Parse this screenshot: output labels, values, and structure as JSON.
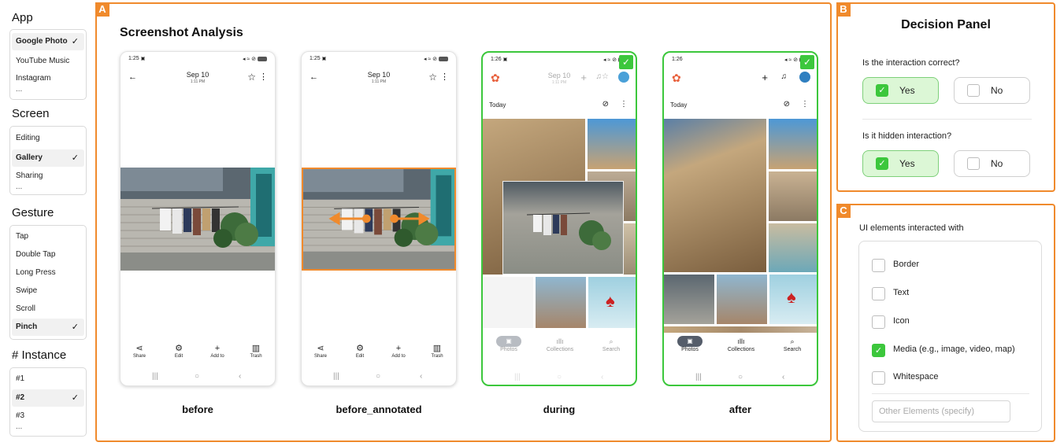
{
  "sidebar": {
    "app": {
      "title": "App",
      "options": [
        "Google Photo",
        "YouTube Music",
        "Instagram"
      ],
      "selected_index": 0
    },
    "screen": {
      "title": "Screen",
      "options": [
        "Editing",
        "Gallery",
        "Sharing"
      ],
      "selected_index": 1
    },
    "gesture": {
      "title": "Gesture",
      "options": [
        "Tap",
        "Double Tap",
        "Long Press",
        "Swipe",
        "Scroll",
        "Pinch"
      ],
      "selected_index": 5
    },
    "instance": {
      "title": "# Instance",
      "options": [
        "#1",
        "#2",
        "#3"
      ],
      "selected_index": 1
    },
    "ellipsis": "...",
    "check": "✓"
  },
  "panel_a": {
    "tag": "A",
    "title": "Screenshot Analysis",
    "phones": [
      {
        "label": "before",
        "time": "1:25",
        "date": "Sep 10",
        "subtime": "1:11 PM"
      },
      {
        "label": "before_annotated",
        "time": "1:25",
        "date": "Sep 10",
        "subtime": "1:11 PM"
      },
      {
        "label": "during",
        "time": "1:26",
        "date": "Sep 10",
        "subtime": "1:11 PM"
      },
      {
        "label": "after",
        "time": "1:26"
      }
    ],
    "bottom_actions": [
      "Share",
      "Edit",
      "Add to",
      "Trash"
    ],
    "gallery": {
      "today": "Today",
      "tabs": [
        "Photos",
        "Collections",
        "Search"
      ]
    }
  },
  "panel_b": {
    "tag": "B",
    "title": "Decision Panel",
    "q1": "Is the interaction correct?",
    "q2": "Is it hidden interaction?",
    "yes": "Yes",
    "no": "No"
  },
  "panel_c": {
    "tag": "C",
    "title": "UI elements interacted with",
    "items": [
      {
        "label": "Border",
        "checked": false
      },
      {
        "label": "Text",
        "checked": false
      },
      {
        "label": "Icon",
        "checked": false
      },
      {
        "label": "Media (e.g., image, video, map)",
        "checked": true
      },
      {
        "label": "Whitespace",
        "checked": false
      }
    ],
    "other_placeholder": "Other Elements (specify)"
  },
  "colors": {
    "accent_orange": "#f08a2c",
    "check_green": "#3cc73c",
    "yes_fill": "#dcf7d6"
  }
}
